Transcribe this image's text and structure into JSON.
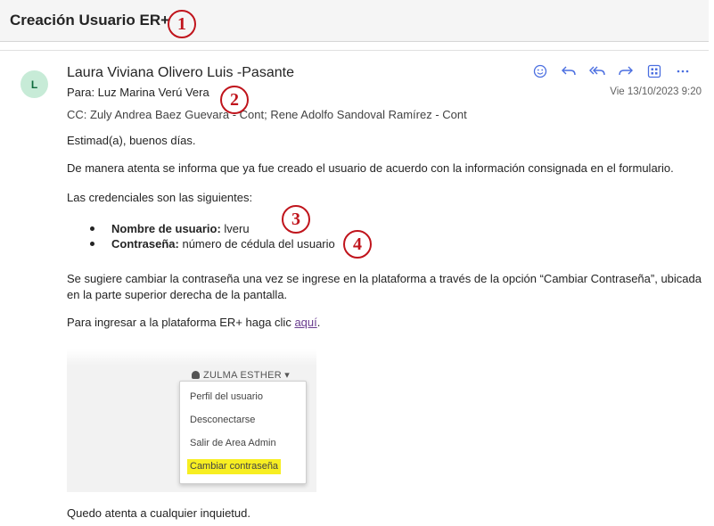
{
  "subject": "Creación Usuario ER+",
  "sender": {
    "avatar_initial": "L",
    "name": "Laura Viviana Olivero Luis -Pasante",
    "to": "Para:  Luz Marina Verú Vera",
    "cc": "CC:  Zuly Andrea Baez Guevara - Cont;  Rene Adolfo Sandoval Ramírez - Cont",
    "date": "Vie 13/10/2023 9:20"
  },
  "actions": [
    {
      "name": "emoji-icon"
    },
    {
      "name": "reply-icon"
    },
    {
      "name": "reply-all-icon"
    },
    {
      "name": "forward-icon"
    },
    {
      "name": "apps-icon"
    },
    {
      "name": "more-icon"
    }
  ],
  "body": {
    "greeting": "Estimad(a), buenos días.",
    "intro": "De manera atenta se informa que ya fue creado el usuario de acuerdo con la información consignada en el formulario.",
    "credentials_intro": "Las credenciales son las siguientes:",
    "credentials": [
      {
        "label": "Nombre de usuario:",
        "value": " lveru"
      },
      {
        "label": "Contraseña:",
        "value": " número de cédula del usuario"
      }
    ],
    "suggestion": "Se sugiere cambiar la contraseña una vez se ingrese en la plataforma a través de la opción “Cambiar Contraseña”, ubicada en la parte superior derecha de la pantalla.",
    "access_text": "Para ingresar a la plataforma ER+ haga clic ",
    "access_link": "aquí",
    "access_end": ".",
    "closing": "Quedo atenta a cualquier inquietud."
  },
  "embedded_screenshot": {
    "user_label": "ZULMA ESTHER ▾",
    "menu_items": [
      "Perfil del usuario",
      "Desconectarse",
      "Salir de Area Admin",
      "Cambiar contraseña"
    ],
    "highlight_color": "#f7ee22"
  },
  "annotations": [
    "1",
    "2",
    "3",
    "4"
  ],
  "colors": {
    "annotation": "#c0141c",
    "accent": "#4a6ee0",
    "avatar_bg": "#c7ebd7"
  }
}
